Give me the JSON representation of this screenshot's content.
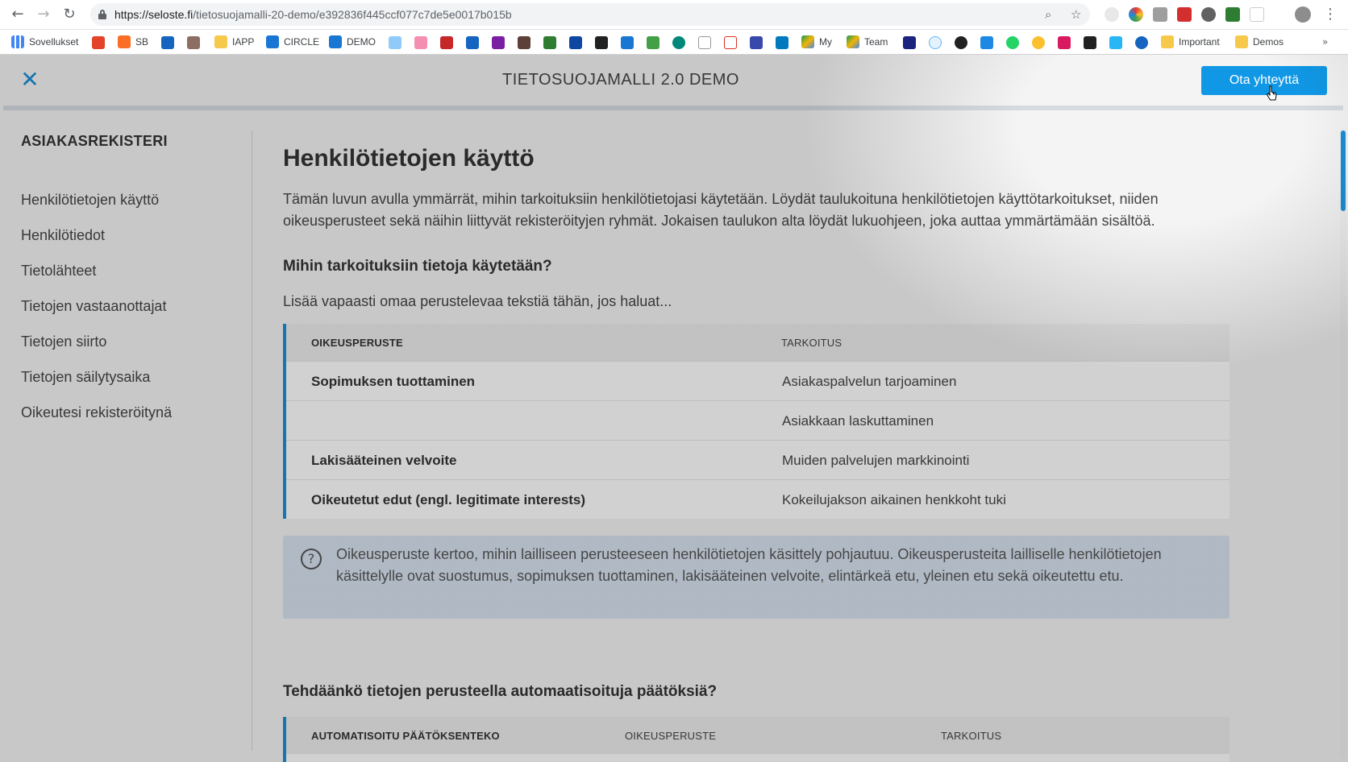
{
  "browser": {
    "url_domain": "https://seloste.fi",
    "url_path": "/tietosuojamalli-20-demo/e392836f445ccf077c7de5e0017b015b",
    "bookmarks": [
      "Sovellukset",
      "SB",
      "IAPP",
      "CIRCLE",
      "DEMO",
      "My",
      "Team",
      "Important",
      "Demos"
    ]
  },
  "header": {
    "title": "TIETOSUOJAMALLI 2.0 DEMO",
    "contact_label": "Ota yhteyttä"
  },
  "sidebar": {
    "heading": "ASIAKASREKISTERI",
    "items": [
      {
        "label": "Henkilötietojen käyttö"
      },
      {
        "label": "Henkilötiedot"
      },
      {
        "label": "Tietolähteet"
      },
      {
        "label": "Tietojen vastaanottajat"
      },
      {
        "label": "Tietojen siirto"
      },
      {
        "label": "Tietojen säilytysaika"
      },
      {
        "label": "Oikeutesi rekisteröitynä"
      }
    ]
  },
  "main": {
    "title": "Henkilötietojen käyttö",
    "intro": "Tämän luvun avulla ymmärrät, mihin tarkoituksiin henkilötietojasi käytetään. Löydät taulukoituna henkilötietojen käyttötarkoitukset, niiden oikeusperusteet sekä näihin liittyvät rekisteröityjen ryhmät. Jokaisen taulukon alta löydät lukuohjeen, joka auttaa ymmärtämään sisältöä.",
    "section1_title": "Mihin tarkoituksiin tietoja käytetään?",
    "section1_lead": "Lisää vapaasti omaa perustelevaa tekstiä tähän, jos haluat...",
    "table1": {
      "headers": [
        "OIKEUSPERUSTE",
        "TARKOITUS"
      ],
      "rows": [
        {
          "basis": "Sopimuksen tuottaminen",
          "purpose": "Asiakaspalvelun tarjoaminen"
        },
        {
          "basis": "",
          "purpose": "Asiakkaan laskuttaminen"
        },
        {
          "basis": "Lakisääteinen velvoite",
          "purpose": "Muiden palvelujen markkinointi"
        },
        {
          "basis": "Oikeutetut edut (engl. legitimate interests)",
          "purpose": "Kokeilujakson aikainen henkkoht tuki"
        }
      ]
    },
    "info_text": "Oikeusperuste kertoo, mihin lailliseen perusteeseen henkilötietojen käsittely pohjautuu. Oikeusperusteita lailliselle henkilötietojen käsittelylle ovat suostumus, sopimuksen tuottaminen, lakisääteinen velvoite, elintärkeä etu, yleinen etu sekä oikeutettu etu.",
    "section2_title": "Tehdäänkö tietojen perusteella automaatisoituja päätöksiä?",
    "table2": {
      "headers": [
        "AUTOMATISOITU PÄÄTÖKSENTEKO",
        "OIKEUSPERUSTE",
        "TARKOITUS"
      ]
    }
  },
  "colors": {
    "accent": "#1a8fd6",
    "button": "#1098e6",
    "info_bg": "#d6e2ef"
  }
}
